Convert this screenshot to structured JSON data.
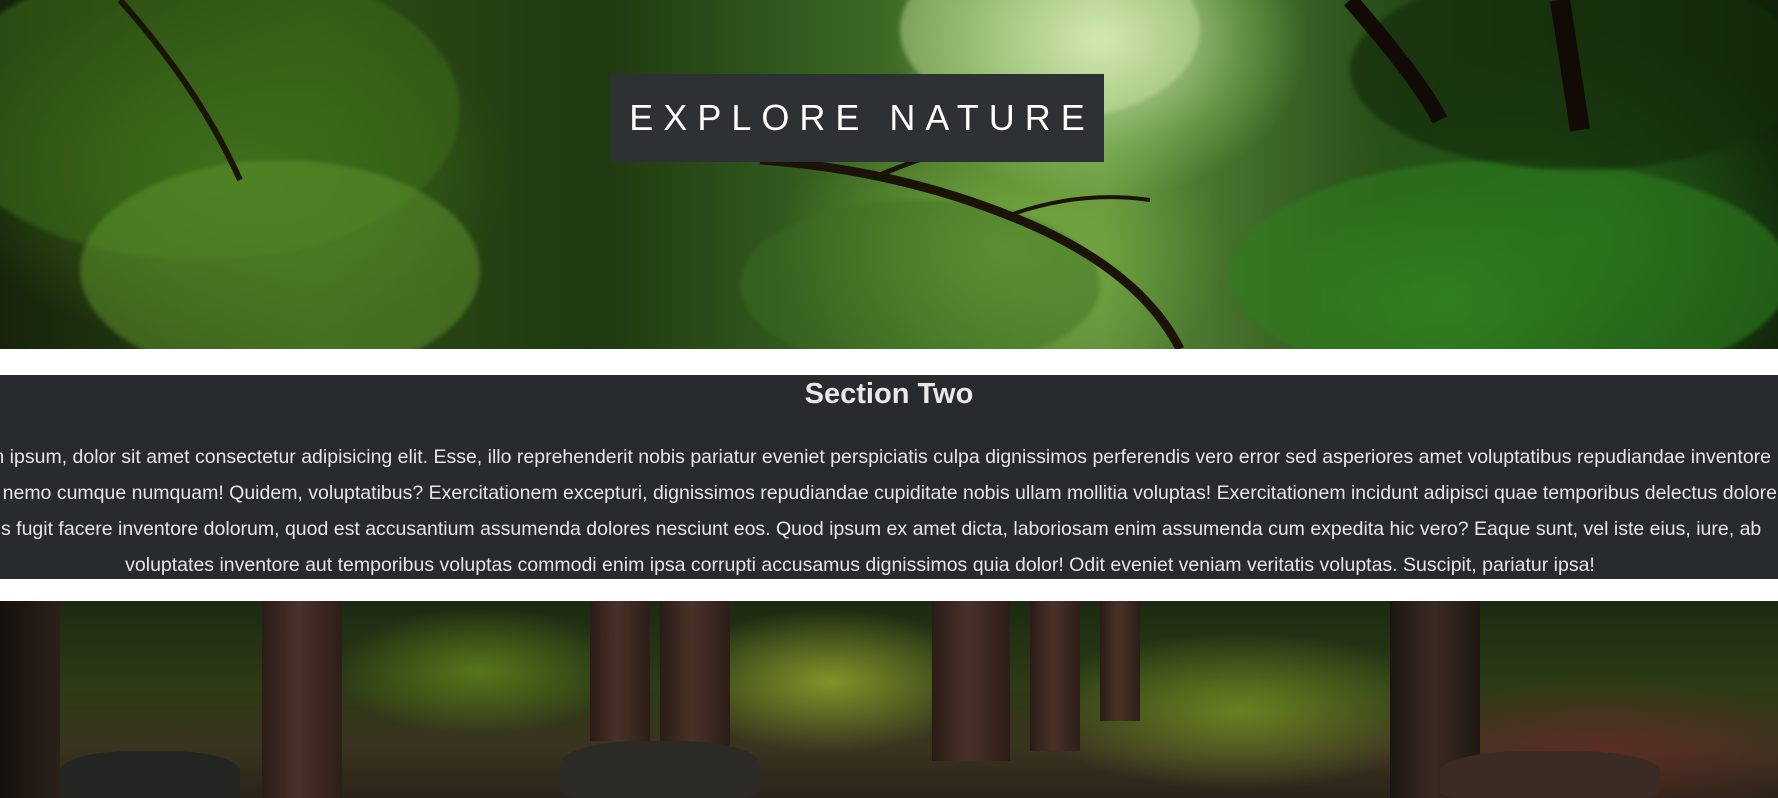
{
  "hero": {
    "title": "EXPLORE NATURE"
  },
  "section_two": {
    "heading": "Section Two",
    "body": "Lorem ipsum, dolor sit amet consectetur adipisicing elit. Esse, illo reprehenderit nobis pariatur eveniet perspiciatis culpa dignissimos perferendis vero error sed asperiores amet voluptatibus repudiandae inventore dolore nemo cumque numquam! Quidem, voluptatibus? Exercitationem excepturi, dignissimos repudiandae cupiditate nobis ullam mollitia voluptas! Exercitationem incidunt adipisci quae temporibus delectus dolore minus fugit facere inventore dolorum, quod est accusantium assumenda dolores nesciunt eos. Quod ipsum ex amet dicta, laboriosam enim assumenda cum expedita hic vero? Eaque sunt, vel iste eius, iure, ab voluptates inventore aut temporibus voluptas commodi enim ipsa corrupti accusamus dignissimos quia dolor! Odit eveniet veniam veritatis voluptas. Suscipit, pariatur ipsa!"
  },
  "colors": {
    "title_box": "#2d3133",
    "section_band": "#272b2e",
    "text": "#e6e6e6"
  }
}
